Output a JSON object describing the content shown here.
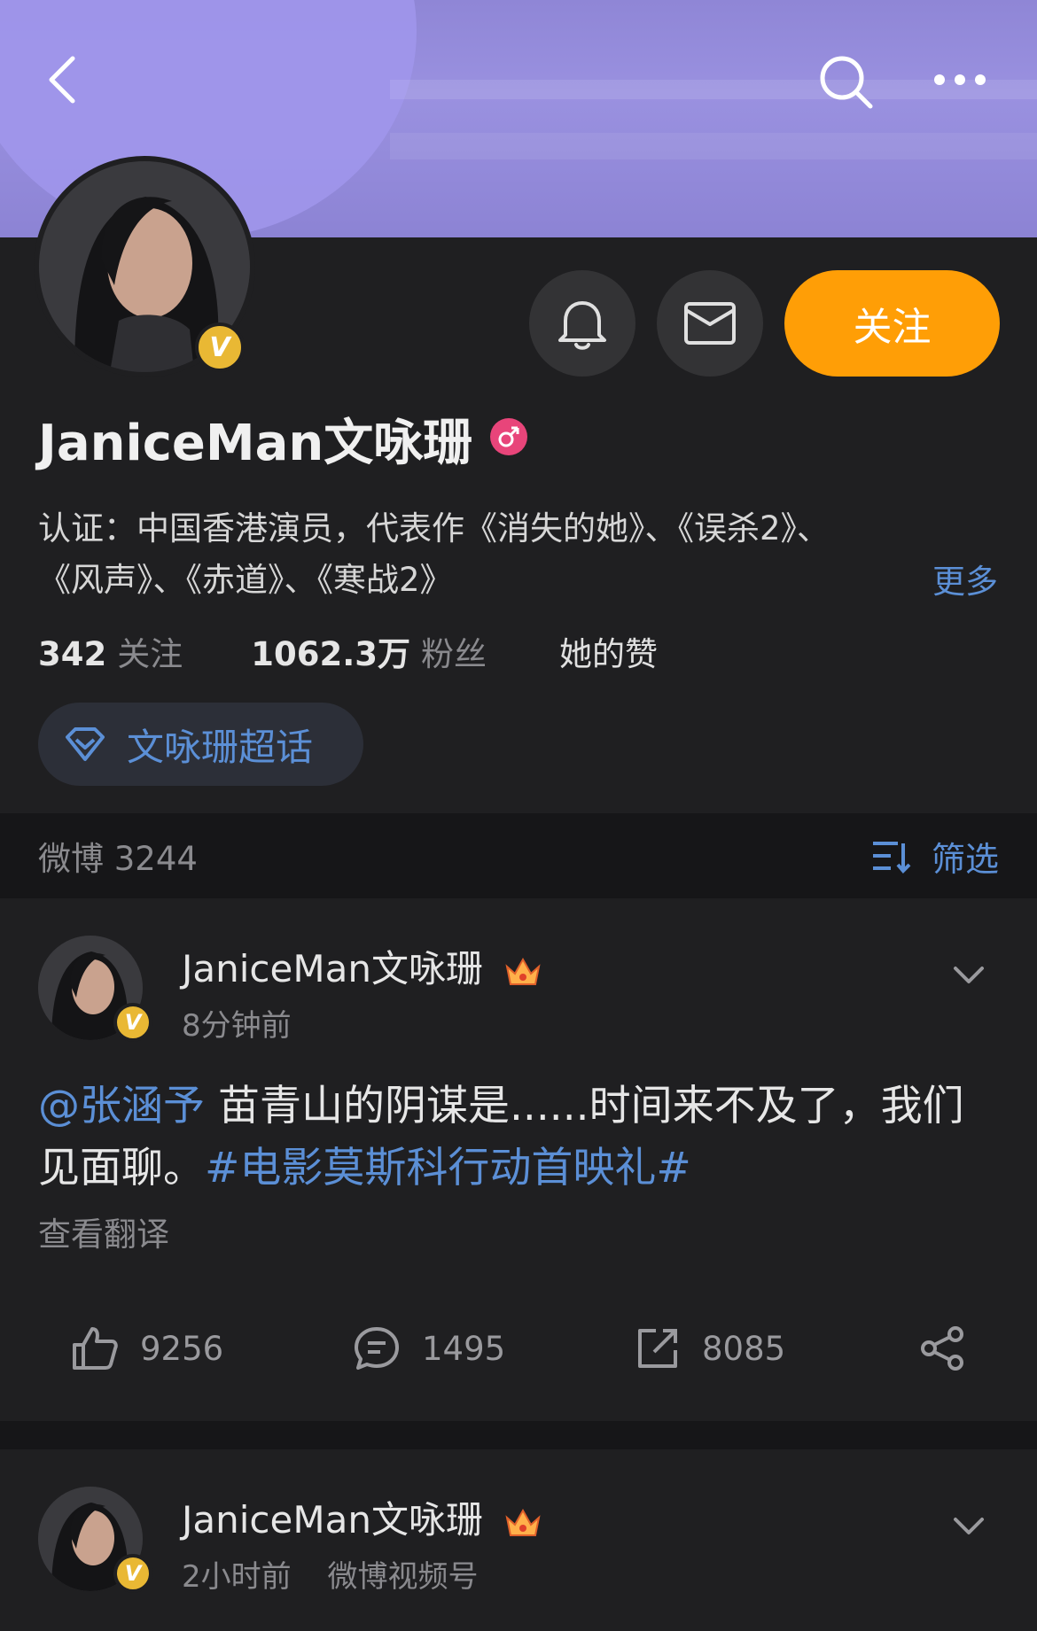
{
  "header": {
    "back_icon": "back-arrow-icon",
    "search_icon": "search-icon",
    "more_icon": "more-dots-icon"
  },
  "profile": {
    "name": "JaniceMan文咏珊",
    "verified_badge": "V",
    "gender_icon": "female-icon",
    "follow_label": "关注",
    "bio_line1": "认证：中国香港演员，代表作《消失的她》、《误杀2》、",
    "bio_line2": "《风声》、《赤道》、《寒战2》",
    "bio_more": "更多",
    "stats": [
      {
        "value": "342",
        "label": "关注"
      },
      {
        "value": "1062.3万",
        "label": "粉丝"
      },
      {
        "value": "",
        "label": "她的赞"
      }
    ],
    "supertopic_label": "文咏珊超话"
  },
  "feed": {
    "count_label": "微博 3244",
    "filter_label": "筛选"
  },
  "posts": [
    {
      "author": "JaniceMan文咏珊",
      "time": "8分钟前",
      "source": "",
      "mention": "@张涵予",
      "text": " 苗青山的阴谋是......时间来不及了，我们见面聊。",
      "hashtag": "#电影莫斯科行动首映礼#",
      "translate": "查看翻译",
      "likes": "9256",
      "comments": "1495",
      "reposts": "8085"
    },
    {
      "author": "JaniceMan文咏珊",
      "time": "2小时前",
      "source": "微博视频号"
    }
  ],
  "colors": {
    "accent_orange": "#ff9e06",
    "link_blue": "#5b8fd6",
    "background": "#1f1f21",
    "banner_purple": "#8f86d6"
  }
}
